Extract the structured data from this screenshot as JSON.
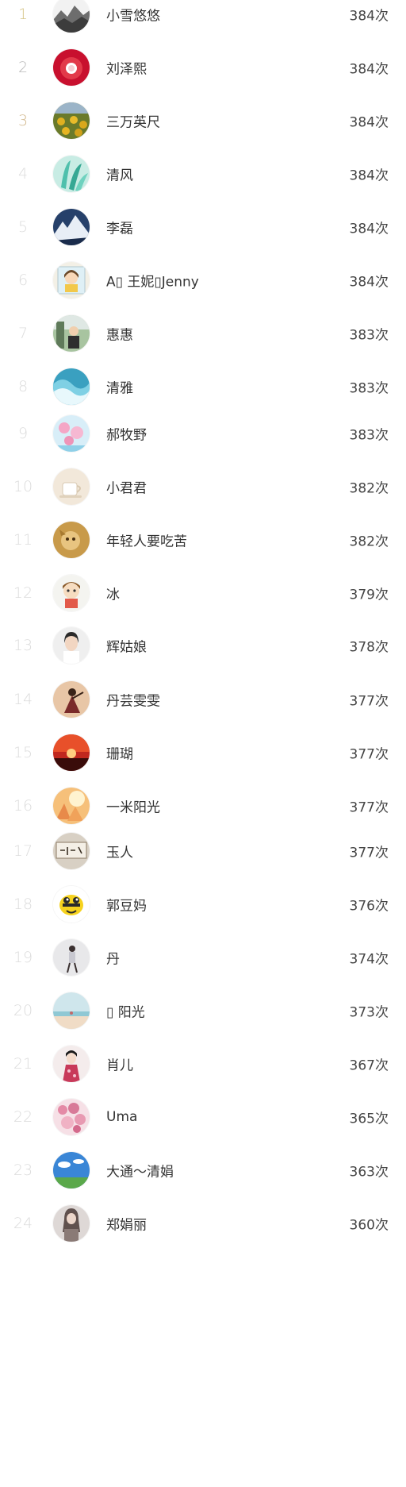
{
  "ranking": {
    "items": [
      {
        "rank": "1",
        "name": "小雪悠悠",
        "count": "384次",
        "avatar": "ink-landscape-avatar"
      },
      {
        "rank": "2",
        "name": "刘泽熙",
        "count": "384次",
        "avatar": "red-flower-avatar"
      },
      {
        "rank": "3",
        "name": "三万英尺",
        "count": "384次",
        "avatar": "sunflower-field-avatar"
      },
      {
        "rank": "4",
        "name": "清风",
        "count": "384次",
        "avatar": "teal-leaves-avatar"
      },
      {
        "rank": "5",
        "name": "李磊",
        "count": "384次",
        "avatar": "snow-mountain-avatar"
      },
      {
        "rank": "6",
        "name": "A▯ 王妮▯Jenny",
        "count": "384次",
        "avatar": "cartoon-girl-avatar"
      },
      {
        "rank": "7",
        "name": "惠惠",
        "count": "383次",
        "avatar": "outdoor-person-avatar"
      },
      {
        "rank": "8",
        "name": "清雅",
        "count": "383次",
        "avatar": "ocean-wave-avatar"
      },
      {
        "rank": "9",
        "name": "郝牧野",
        "count": "383次",
        "avatar": "pink-flowers-avatar"
      },
      {
        "rank": "10",
        "name": "小君君",
        "count": "382次",
        "avatar": "teacup-avatar"
      },
      {
        "rank": "11",
        "name": "年轻人要吃苦",
        "count": "382次",
        "avatar": "golden-animal-avatar"
      },
      {
        "rank": "12",
        "name": "冰",
        "count": "379次",
        "avatar": "cartoon-doll-avatar"
      },
      {
        "rank": "13",
        "name": "辉姑娘",
        "count": "378次",
        "avatar": "woman-portrait-avatar"
      },
      {
        "rank": "14",
        "name": "丹芸雯雯",
        "count": "377次",
        "avatar": "dancer-avatar"
      },
      {
        "rank": "15",
        "name": "珊瑚",
        "count": "377次",
        "avatar": "sunset-avatar"
      },
      {
        "rank": "16",
        "name": "一米阳光",
        "count": "377次",
        "avatar": "sunlight-avatar"
      },
      {
        "rank": "17",
        "name": "玉人",
        "count": "377次",
        "avatar": "calligraphy-sign-avatar"
      },
      {
        "rank": "18",
        "name": "郭豆妈",
        "count": "376次",
        "avatar": "bee-cartoon-avatar"
      },
      {
        "rank": "19",
        "name": "丹",
        "count": "374次",
        "avatar": "walking-woman-avatar"
      },
      {
        "rank": "20",
        "name": "▯ 阳光",
        "count": "373次",
        "avatar": "beach-avatar"
      },
      {
        "rank": "21",
        "name": "肖儿",
        "count": "367次",
        "avatar": "qipao-woman-avatar"
      },
      {
        "rank": "22",
        "name": "Uma",
        "count": "365次",
        "avatar": "blossom-avatar"
      },
      {
        "rank": "23",
        "name": "大通～清娟",
        "count": "363次",
        "avatar": "blue-sky-avatar"
      },
      {
        "rank": "24",
        "name": "郑娟丽",
        "count": "360次",
        "avatar": "woman-silhouette-avatar"
      }
    ]
  },
  "colors": {
    "rank_default": "#dcdcdc",
    "rank_gold": "#d6c68a",
    "rank_silver": "#b9b9b9",
    "rank_bronze": "#d2b98f",
    "name_text": "#333333",
    "count_text": "#444444",
    "background": "#ffffff"
  }
}
